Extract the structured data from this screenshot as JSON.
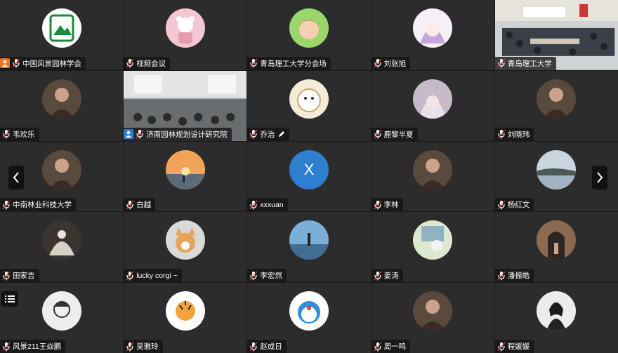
{
  "participants": [
    {
      "name": "中国风景园林学会",
      "avatar": "cla-logo-icon",
      "host": true
    },
    {
      "name": "视频会议",
      "avatar": "bear-avatar-icon"
    },
    {
      "name": "青岛理工大学分会场",
      "avatar": "cartoon-girl-avatar-icon"
    },
    {
      "name": "刘张旭",
      "avatar": "anime-girl-avatar-icon"
    },
    {
      "name": "青岛理工大学",
      "video": true
    },
    {
      "name": "韦欢乐",
      "avatar": "photo-avatar-icon"
    },
    {
      "name": "济南园林规划设计研究院",
      "video": true,
      "host": true,
      "active": true
    },
    {
      "name": "乔治",
      "avatar": "cartoon-avatar-icon",
      "editing": true
    },
    {
      "name": "鹿黎半夏",
      "avatar": "anime-avatar-icon"
    },
    {
      "name": "刘晓玮",
      "avatar": "photo-avatar-icon"
    },
    {
      "name": "中南林业科技大学",
      "avatar": "photo-avatar-icon"
    },
    {
      "name": "白越",
      "avatar": "sunset-avatar-icon"
    },
    {
      "name": "xxxuan",
      "avatar": "letter-avatar",
      "letter": "X"
    },
    {
      "name": "李林",
      "avatar": "photo-avatar-icon"
    },
    {
      "name": "杨红文",
      "avatar": "lake-avatar-icon"
    },
    {
      "name": "田家吉",
      "avatar": "statue-avatar-icon"
    },
    {
      "name": "lucky corgi ~",
      "avatar": "dog-avatar-icon"
    },
    {
      "name": "李宏然",
      "avatar": "beach-avatar-icon"
    },
    {
      "name": "姜涛",
      "avatar": "cat-avatar-icon"
    },
    {
      "name": "潘振皓",
      "avatar": "arch-avatar-icon"
    },
    {
      "name": "风景211王焱鹏",
      "avatar": "sketch-avatar-icon"
    },
    {
      "name": "吴雅玲",
      "avatar": "tiger-avatar-icon"
    },
    {
      "name": "赵成日",
      "avatar": "doraemon-avatar-icon"
    },
    {
      "name": "周一鸣",
      "avatar": "photo-avatar-icon"
    },
    {
      "name": "程媛媛",
      "avatar": "portrait-avatar-icon"
    }
  ],
  "colors": {
    "tile": "#2c2c2c",
    "active_border": "#2fb34a",
    "host_badge": "#f37321",
    "letter_avatar": "#2f7fd1"
  }
}
